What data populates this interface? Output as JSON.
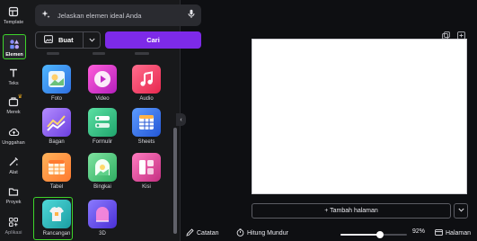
{
  "rail": {
    "items": [
      {
        "label": "Template",
        "icon": "template-icon"
      },
      {
        "label": "Elemen",
        "icon": "elements-icon"
      },
      {
        "label": "Teks",
        "icon": "text-icon"
      },
      {
        "label": "Merek",
        "icon": "brand-icon"
      },
      {
        "label": "Unggahan",
        "icon": "upload-icon"
      },
      {
        "label": "Alat",
        "icon": "tools-icon"
      },
      {
        "label": "Proyek",
        "icon": "folder-icon"
      },
      {
        "label": "Aplikasi",
        "icon": "apps-icon"
      }
    ]
  },
  "search": {
    "placeholder": "Jelaskan elemen ideal Anda"
  },
  "modes": {
    "create": "Buat",
    "search": "Cari"
  },
  "elements": [
    {
      "label": "Foto",
      "icon": "photo-icon",
      "color": "#8fd3ff"
    },
    {
      "label": "Video",
      "icon": "video-icon",
      "color": "#e83ad0"
    },
    {
      "label": "Audio",
      "icon": "audio-icon",
      "color": "#ff4f7b"
    },
    {
      "label": "Bagan",
      "icon": "chart-icon",
      "color": "#8a5cf5"
    },
    {
      "label": "Formulir",
      "icon": "form-icon",
      "color": "#3dc98b"
    },
    {
      "label": "Sheets",
      "icon": "sheets-icon",
      "color": "#3a7bff"
    },
    {
      "label": "Tabel",
      "icon": "table-icon",
      "color": "#ff9d3c"
    },
    {
      "label": "Bingkai",
      "icon": "frame-icon",
      "color": "#5fd18a"
    },
    {
      "label": "Kisi",
      "icon": "grid-icon",
      "color": "#e0509a"
    },
    {
      "label": "Rancangan",
      "icon": "mockup-icon",
      "color": "#34c6c9"
    },
    {
      "label": "3D",
      "icon": "3d-icon",
      "color": "#7c5cff"
    }
  ],
  "canvas": {
    "add_page": "+ Tambah halaman"
  },
  "footer": {
    "notes": "Catatan",
    "timer": "Hitung Mundur",
    "zoom": "92%",
    "zoom_value": 0.6,
    "pages": "Halaman"
  }
}
